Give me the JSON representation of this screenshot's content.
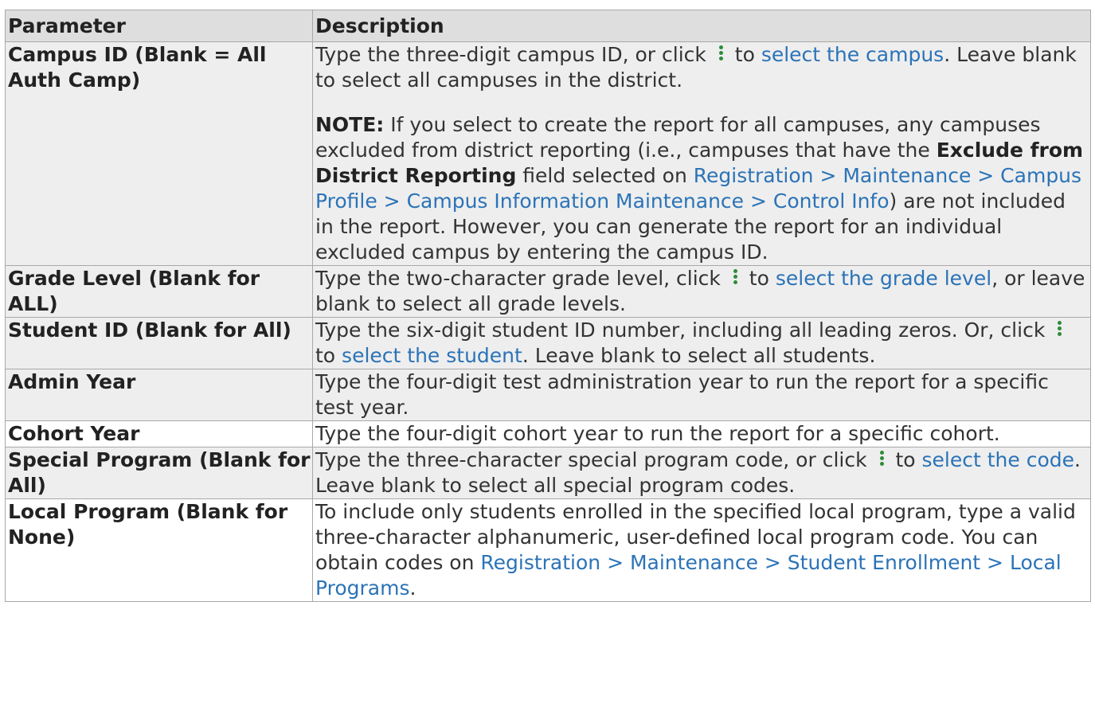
{
  "table": {
    "headers": [
      "Parameter",
      "Description"
    ],
    "rows": [
      {
        "param": "Campus ID (Blank = All Auth Camp)",
        "desc_pre": "Type the three-digit campus ID, or click ",
        "desc_mid": " to ",
        "link": "select the campus",
        "desc_post": ". Leave blank to select all campuses in the district.",
        "note_label": "NOTE:",
        "note_text1": " If you select to create the report for all campuses, any campuses excluded from district reporting (i.e., campuses that have the ",
        "note_bold": "Exclude from District Reporting",
        "note_text2": " field selected on ",
        "note_link": "Registration > Maintenance > Campus Profile > Campus Information Maintenance > Control Info",
        "note_text3": ") are not included in the report. However, you can generate the report for an individual excluded campus by entering the campus ID."
      },
      {
        "param": "Grade Level (Blank for ALL)",
        "desc_pre": "Type the two-character grade level, click ",
        "desc_mid": " to ",
        "link": "select the grade level",
        "desc_post": ", or leave blank to select all grade levels."
      },
      {
        "param": "Student ID (Blank for All)",
        "desc_pre": "Type the six-digit student ID number, including all leading zeros. Or, click ",
        "desc_mid": " to ",
        "link": "select the student",
        "desc_post": ". Leave blank to select all students."
      },
      {
        "param": "Admin Year",
        "desc": "Type the four-digit test administration year to run the report for a specific test year."
      },
      {
        "param": "Cohort Year",
        "desc": "Type the four-digit cohort year to run the report for a specific cohort."
      },
      {
        "param": "Special Program (Blank for All)",
        "desc_pre": "Type the three-character special program code, or click ",
        "desc_mid": " to ",
        "link": "select the code",
        "desc_post": ". Leave blank to select all special program codes."
      },
      {
        "param": "Local Program (Blank for None)",
        "desc_pre": "To include only students enrolled in the specified local program, type a valid three-character alphanumeric, user-defined local program code. You can obtain codes on ",
        "link": "Registration > Maintenance > Student Enrollment > Local Programs",
        "desc_post": "."
      }
    ]
  },
  "colors": {
    "link": "#2b73b7",
    "icon": "#2e8b3a",
    "header_bg": "#dedede",
    "row_shade": "#eeeeee"
  }
}
